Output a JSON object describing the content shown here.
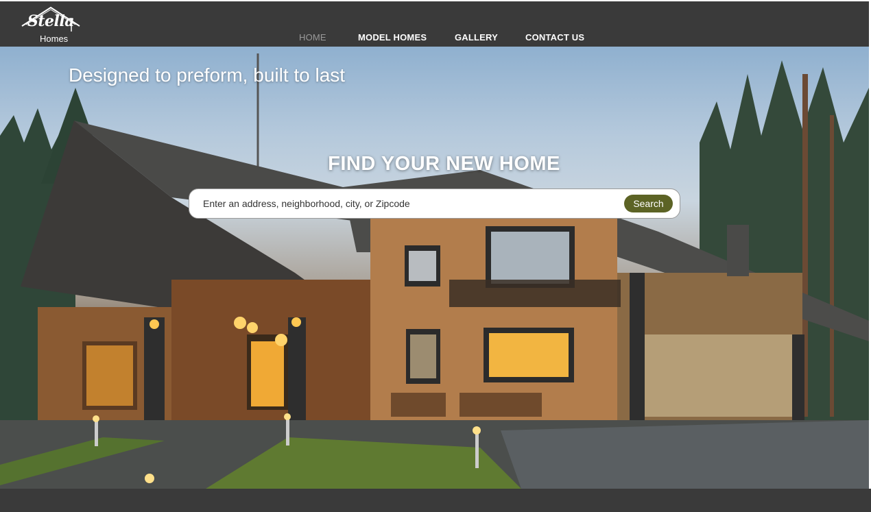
{
  "brand": {
    "logo_script": "Stella",
    "logo_sub": "Homes"
  },
  "nav": {
    "items": [
      {
        "label": "HOME",
        "active": true
      },
      {
        "label": "MODEL HOMES",
        "active": false
      },
      {
        "label": "GALLERY",
        "active": false
      },
      {
        "label": "CONTACT US",
        "active": false
      }
    ]
  },
  "hero": {
    "tagline": "Designed to preform, built to last",
    "title": "FIND YOUR NEW HOME",
    "background": "log-house-photo"
  },
  "search": {
    "placeholder": "Enter an address, neighborhood, city, or Zipcode",
    "value": "",
    "button_label": "Search"
  },
  "colors": {
    "header_bg": "#3a3a3a",
    "accent": "#5c6325",
    "nav_active": "#9a9a9a"
  }
}
